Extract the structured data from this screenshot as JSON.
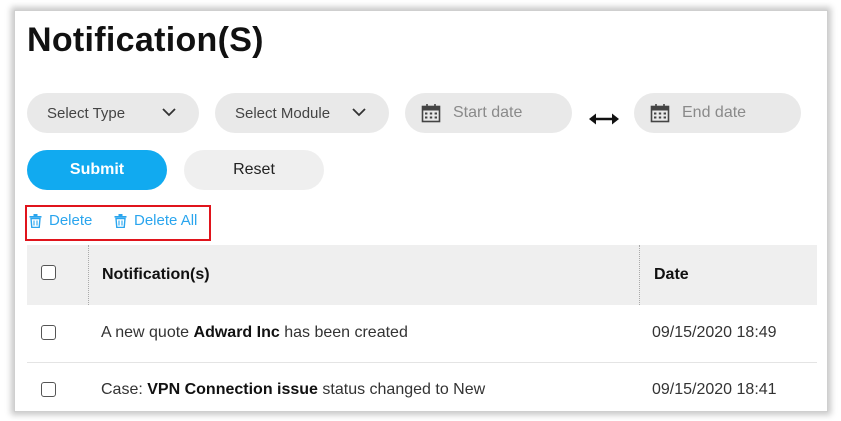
{
  "page": {
    "title": "Notification(S)"
  },
  "filters": {
    "type_select": "Select Type",
    "module_select": "Select Module",
    "start_date_placeholder": "Start date",
    "end_date_placeholder": "End date"
  },
  "buttons": {
    "submit": "Submit",
    "reset": "Reset"
  },
  "actions": {
    "delete": "Delete",
    "delete_all": "Delete All"
  },
  "table": {
    "headers": {
      "notifications": "Notification(s)",
      "date": "Date"
    },
    "rows": [
      {
        "prefix": "A new quote ",
        "bold": "Adward Inc",
        "suffix": " has been created",
        "date": "09/15/2020 18:49"
      },
      {
        "prefix": "Case: ",
        "bold": "VPN Connection issue",
        "suffix": " status changed to New",
        "date": "09/15/2020 18:41"
      }
    ]
  },
  "colors": {
    "accent": "#11aaf0",
    "link": "#2aa5ee",
    "highlight_border": "#e0141c",
    "pill_bg": "#e9e9e9"
  }
}
